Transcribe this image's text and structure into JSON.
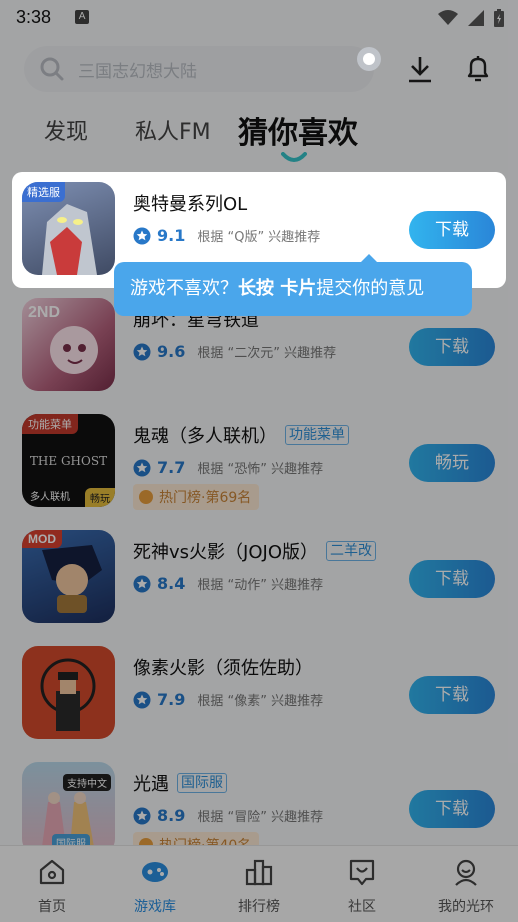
{
  "status_bar": {
    "time": "3:38",
    "notif_letter": "A"
  },
  "search": {
    "placeholder": "三国志幻想大陆"
  },
  "tabs": [
    {
      "label": "发现",
      "active": false
    },
    {
      "label": "私人FM",
      "active": false
    },
    {
      "label": "猜你喜欢",
      "active": true
    }
  ],
  "games": [
    {
      "title": "奥特曼系列OL",
      "tag": "",
      "score": "9.1",
      "reason": "根据 “Q版” 兴趣推荐",
      "rank": "",
      "action": "下载",
      "icon_badge": "精选服"
    },
    {
      "title": "崩坏：星穹铁道",
      "tag": "",
      "score": "9.6",
      "reason": "根据 “二次元” 兴趣推荐",
      "rank": "",
      "action": "下载",
      "icon_badge": "2ND"
    },
    {
      "title": "鬼魂（多人联机）",
      "tag": "功能菜单",
      "score": "7.7",
      "reason": "根据 “恐怖” 兴趣推荐",
      "rank": "热门榜·第69名",
      "action": "畅玩",
      "icon_badge": "功能菜单",
      "icon_text": "THE GHOST",
      "icon_sub": "多人联机",
      "icon_sub2": "畅玩"
    },
    {
      "title": "死神vs火影（JOJO版）",
      "tag": "二羊改",
      "score": "8.4",
      "reason": "根据 “动作” 兴趣推荐",
      "rank": "",
      "action": "下载",
      "icon_badge": "MOD"
    },
    {
      "title": "像素火影（须佐佐助）",
      "tag": "",
      "score": "7.9",
      "reason": "根据 “像素” 兴趣推荐",
      "rank": "",
      "action": "下载",
      "icon_badge": ""
    },
    {
      "title": "光遇",
      "tag": "国际服",
      "score": "8.9",
      "reason": "根据 “冒险” 兴趣推荐",
      "rank": "热门榜·第40名",
      "action": "下载",
      "icon_badge": "支持中文",
      "icon_sub": "国际服"
    }
  ],
  "tooltip": {
    "part1": "游戏不喜欢？",
    "part2": "长按 卡片",
    "part3": "提交你的意见"
  },
  "bottom_nav": [
    {
      "label": "首页",
      "icon": "home-icon",
      "active": false
    },
    {
      "label": "游戏库",
      "icon": "gamepad-icon",
      "active": true
    },
    {
      "label": "排行榜",
      "icon": "ranking-icon",
      "active": false
    },
    {
      "label": "社区",
      "icon": "community-icon",
      "active": false
    },
    {
      "label": "我的光环",
      "icon": "profile-icon",
      "active": false
    }
  ],
  "colors": {
    "accent": "#2a8ee0",
    "tooltip": "#4aa6eb",
    "rank_bg": "#fbe8d2"
  }
}
